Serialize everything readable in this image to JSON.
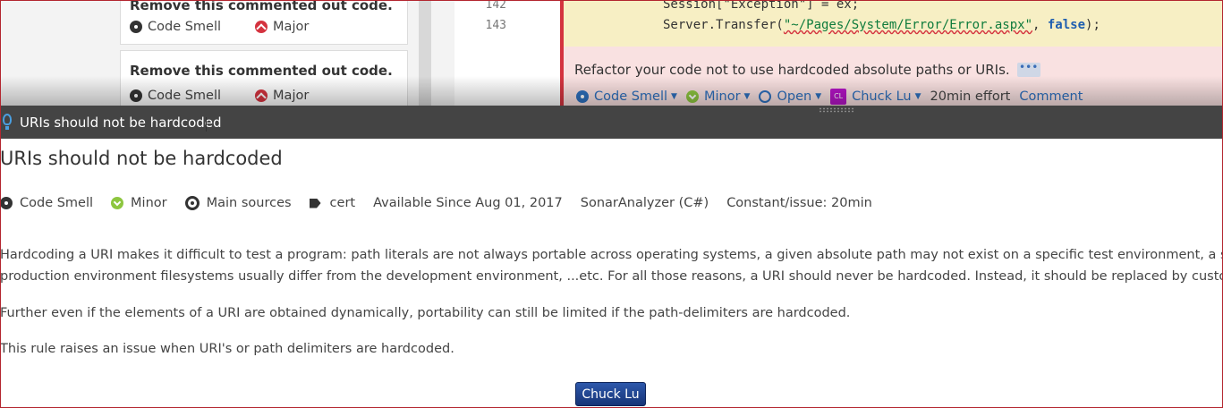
{
  "issues_list": [
    {
      "message": "Remove this commented out code.",
      "type": "Code Smell",
      "severity": "Major"
    },
    {
      "message": "Remove this commented out code.",
      "type": "Code Smell",
      "severity": "Major"
    }
  ],
  "code": {
    "lines": [
      {
        "number": "142",
        "text": "Session[\"Exception\"] = ex;"
      },
      {
        "number": "143",
        "pre": "Server.Transfer(",
        "string": "\"~/Pages/System/Error/Error.aspx\"",
        "mid": ", ",
        "keyword": "false",
        "post": ");"
      }
    ],
    "issue": {
      "message": "Refactor your code not to use hardcoded absolute paths or URIs.",
      "more": "•••",
      "type": "Code Smell",
      "severity": "Minor",
      "status": "Open",
      "assignee_initials": "CL",
      "assignee": "Chuck Lu",
      "effort": "20min effort",
      "comment": "Comment"
    }
  },
  "rule": {
    "header_title": "URIs should not be hardcoded",
    "title": "URIs should not be hardcoded",
    "type": "Code Smell",
    "severity": "Minor",
    "scope": "Main sources",
    "tag": "cert",
    "available_since": "Available Since Aug 01, 2017",
    "repository": "SonarAnalyzer (C#)",
    "remediation": "Constant/issue: 20min",
    "description": [
      "Hardcoding a URI makes it difficult to test a program: path literals are not always portable across operating systems, a given absolute path may not exist on a specific test environment, a specif",
      "production environment filesystems usually differ from the development environment, ...etc. For all those reasons, a URI should never be hardcoded. Instead, it should be replaced by customiza",
      "Further even if the elements of a URI are obtained dynamically, portability can still be limited if the path-delimiters are hardcoded.",
      "This rule raises an issue when URI's or path delimiters are hardcoded."
    ]
  },
  "overlay_button": "Chuck Lu",
  "colors": {
    "accent": "#2d6fbd",
    "major": "#d4333f",
    "minor": "#8dc63f",
    "header": "#444444"
  }
}
